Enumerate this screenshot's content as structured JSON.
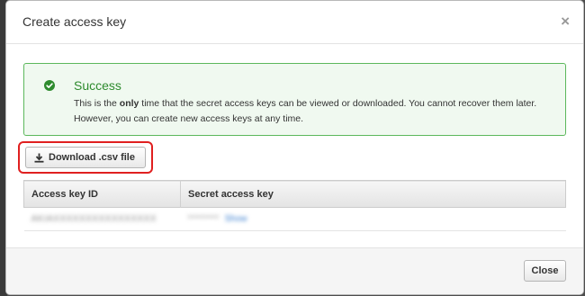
{
  "dialog": {
    "title": "Create access key",
    "close_glyph": "×"
  },
  "alert": {
    "icon": "check-circle-icon",
    "status_color": "#5cb85c",
    "title": "Success",
    "body_before": "This is the ",
    "body_bold": "only",
    "body_after": " time that the secret access keys can be viewed or downloaded. You cannot recover them later. However, you can create new access keys at any time."
  },
  "download": {
    "icon": "download-icon",
    "label": "Download .csv file",
    "highlight_color": "#e02020"
  },
  "table": {
    "headers": [
      "Access key ID",
      "Secret access key"
    ],
    "rows": [
      {
        "access_key_id": "AKIAXXXXXXXXXXXXXXXX",
        "secret": "********",
        "show_link": "Show"
      }
    ]
  },
  "footer": {
    "close_label": "Close"
  }
}
